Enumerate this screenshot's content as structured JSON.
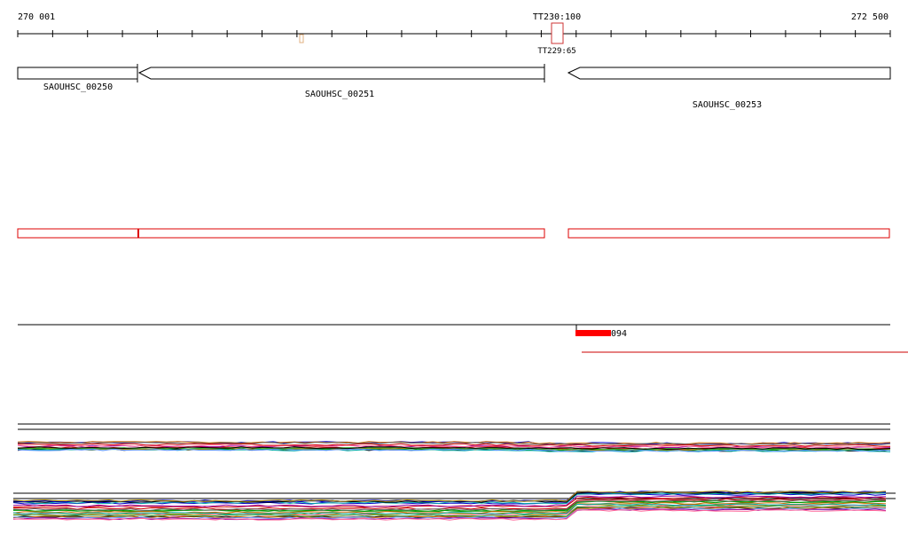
{
  "ruler": {
    "start_label": "270 001",
    "end_label": "272 500",
    "tt_top_label": "TT230:100",
    "tt_bottom_label": "TT229:65"
  },
  "genes": {
    "gene_a": "SAOUHSC_00250",
    "gene_b": "SAOUHSC_00251",
    "gene_c": "SAOUHSC_00253"
  },
  "feature": {
    "label": "094"
  },
  "colors": {
    "gene_outline": "#000000",
    "annotation_outline": "#dd0000",
    "feature_fill": "#ff0000",
    "terminator_outline": "#cc3333",
    "tracks": [
      "#000000",
      "#cc0000",
      "#009900",
      "#0000cc",
      "#cc6600",
      "#990099",
      "#00aaaa",
      "#666666",
      "#aa8800",
      "#ff6699",
      "#6699ff",
      "#33aa33"
    ]
  }
}
